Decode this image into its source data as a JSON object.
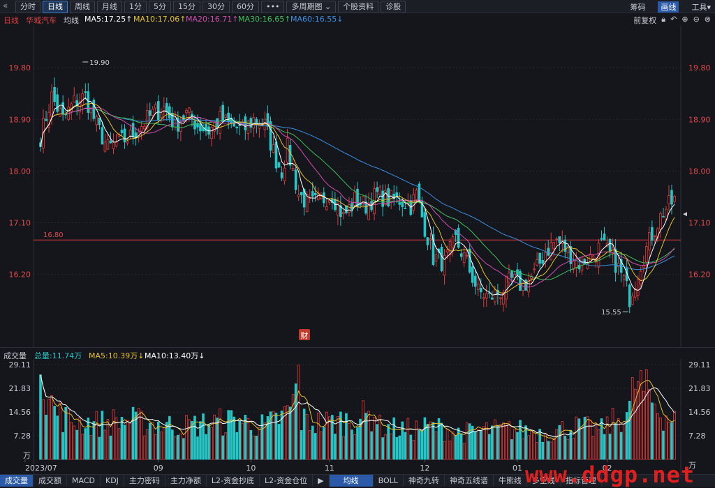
{
  "toolbar": {
    "back_icon": "«",
    "tabs": [
      "分时",
      "日线",
      "周线",
      "月线",
      "1分",
      "5分",
      "15分",
      "30分",
      "60分",
      "•••",
      "多周期图 ⌄",
      "个股资料",
      "诊股"
    ],
    "active_tab": "日线",
    "right_items": [
      "筹码",
      "画线",
      "工具▾"
    ]
  },
  "ma_bar": {
    "period": "日线",
    "name": "华城汽车",
    "avg": "均线",
    "ma5": "MA5:17.25↑",
    "ma10": "MA10:17.06↑",
    "ma20": "MA20:16.71↑",
    "ma30": "MA30:16.65↑",
    "ma60": "MA60:16.55↓",
    "adjust": "前复权",
    "icons": [
      "lock-icon",
      "undo-icon",
      "zoom-in-icon",
      "zoom-out-icon",
      "close-icon"
    ]
  },
  "colors": {
    "up": "#e23b3b",
    "down": "#26c6c6",
    "ma5": "#ffffff",
    "ma10": "#e5c02b",
    "ma20": "#d14fb0",
    "ma30": "#3fbf5a",
    "ma60": "#3a8fe0",
    "bg": "#14161c"
  },
  "chart_data": [
    {
      "type": "candlestick",
      "y_ticks": [
        "19.80",
        "18.90",
        "18.00",
        "17.10",
        "16.20"
      ],
      "y_tick_values": [
        19.8,
        18.9,
        18.0,
        17.1,
        16.2
      ],
      "ylim": [
        15.2,
        20.3
      ],
      "high_label": "19.90",
      "high_value": 19.9,
      "low_label": "15.55",
      "low_value": 15.55,
      "ref_line": {
        "label": "16.80",
        "value": 16.8
      },
      "finance_badge": "财",
      "month_labels": [
        "2023/07",
        "09",
        "10",
        "11",
        "12",
        "01",
        "02"
      ],
      "ma_last": {
        "ma5": 17.25,
        "ma10": 17.06,
        "ma20": 16.71,
        "ma30": 16.65,
        "ma60": 16.55
      },
      "close_keyframes": [
        [
          0,
          18.6
        ],
        [
          4,
          19.3
        ],
        [
          8,
          18.9
        ],
        [
          12,
          19.2
        ],
        [
          16,
          19.3
        ],
        [
          20,
          18.8
        ],
        [
          24,
          18.4
        ],
        [
          28,
          18.5
        ],
        [
          32,
          18.6
        ],
        [
          36,
          18.8
        ],
        [
          40,
          19.0
        ],
        [
          44,
          19.1
        ],
        [
          48,
          18.8
        ],
        [
          52,
          19.0
        ],
        [
          56,
          18.8
        ],
        [
          60,
          18.7
        ],
        [
          64,
          18.9
        ],
        [
          68,
          18.8
        ],
        [
          72,
          18.7
        ],
        [
          76,
          18.9
        ],
        [
          80,
          18.8
        ],
        [
          84,
          18.2
        ],
        [
          86,
          18.0
        ],
        [
          88,
          18.4
        ],
        [
          92,
          17.6
        ],
        [
          96,
          17.4
        ],
        [
          100,
          17.5
        ],
        [
          104,
          17.6
        ],
        [
          108,
          17.2
        ],
        [
          112,
          17.5
        ],
        [
          116,
          17.4
        ],
        [
          120,
          17.6
        ],
        [
          124,
          17.5
        ],
        [
          128,
          17.5
        ],
        [
          132,
          17.4
        ],
        [
          134,
          17.6
        ],
        [
          136,
          17.2
        ],
        [
          140,
          16.5
        ],
        [
          144,
          16.4
        ],
        [
          148,
          16.8
        ],
        [
          152,
          16.4
        ],
        [
          156,
          15.9
        ],
        [
          160,
          15.8
        ],
        [
          164,
          15.9
        ],
        [
          168,
          16.1
        ],
        [
          172,
          16.0
        ],
        [
          176,
          16.2
        ],
        [
          180,
          16.6
        ],
        [
          184,
          16.8
        ],
        [
          188,
          16.6
        ],
        [
          192,
          16.4
        ],
        [
          196,
          16.5
        ],
        [
          200,
          16.7
        ],
        [
          204,
          16.5
        ],
        [
          208,
          16.1
        ],
        [
          210,
          15.8
        ],
        [
          214,
          16.4
        ],
        [
          218,
          16.9
        ],
        [
          222,
          17.3
        ],
        [
          226,
          17.5
        ]
      ]
    },
    {
      "type": "bar",
      "title": "成交量",
      "total": "总量:11.74万",
      "ma5": "MA5:10.39万↓",
      "ma10": "MA10:13.40万↓",
      "y_ticks": [
        "29.11",
        "21.83",
        "14.56",
        "7.28",
        "万"
      ],
      "y_tick_values": [
        29.11,
        21.83,
        14.56,
        7.28,
        0
      ],
      "ylim": [
        0,
        30
      ],
      "unit": "万",
      "volume_keyframes": [
        [
          0,
          26
        ],
        [
          5,
          15
        ],
        [
          10,
          12
        ],
        [
          20,
          11
        ],
        [
          30,
          12
        ],
        [
          40,
          11
        ],
        [
          50,
          10
        ],
        [
          60,
          11
        ],
        [
          70,
          12
        ],
        [
          80,
          10
        ],
        [
          88,
          14
        ],
        [
          92,
          22
        ],
        [
          93,
          12
        ],
        [
          100,
          11
        ],
        [
          110,
          12
        ],
        [
          120,
          14
        ],
        [
          121,
          10
        ],
        [
          130,
          9
        ],
        [
          140,
          10
        ],
        [
          150,
          8
        ],
        [
          160,
          9
        ],
        [
          170,
          9
        ],
        [
          180,
          8
        ],
        [
          190,
          10
        ],
        [
          200,
          9
        ],
        [
          210,
          15
        ],
        [
          212,
          24
        ],
        [
          216,
          20
        ],
        [
          222,
          14
        ],
        [
          226,
          12
        ]
      ]
    }
  ],
  "bottom_tabs": [
    "成交量",
    "成交额",
    "MACD",
    "KDJ",
    "主力密码",
    "主力净额",
    "L2-资金抄底",
    "L2-资金仓位",
    "▶",
    "均线",
    "BOLL",
    "神奇九转",
    "神奇五线谱",
    "牛熊线",
    "多空线",
    "指标管理"
  ],
  "watermark": "www.ddgp.net"
}
